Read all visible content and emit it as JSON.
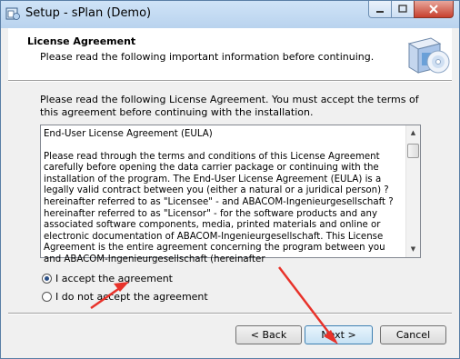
{
  "window": {
    "title": "Setup - sPlan (Demo)",
    "accent_color": "#c7402e"
  },
  "header": {
    "title": "License Agreement",
    "subtitle": "Please read the following important information before continuing.",
    "graphic_icon": "setup-box-with-disc-icon"
  },
  "body": {
    "intro": "Please read the following License Agreement. You must accept the terms of this agreement before continuing with the installation.",
    "license_paragraphs": [
      "End-User License Agreement (EULA)",
      "Please read through the terms and conditions of this License Agreement carefully before opening the data carrier package or continuing with the installation of the program. The End-User License Agreement (EULA) is a legally valid contract between you (either a natural or a juridical person) ?hereinafter referred to as \"Licensee\" - and ABACOM-Ingenieurgesellschaft ?hereinafter referred to as \"Licensor\" - for the software products and any associated software components, media, printed materials and online or electronic documentation of ABACOM-Ingenieurgesellschaft. This License Agreement is the entire agreement concerning the program between you and ABACOM-Ingenieurgesellschaft (hereinafter"
    ]
  },
  "options": {
    "accept_label": "I accept the agreement",
    "decline_label": "I do not accept the agreement",
    "selected": "accept"
  },
  "buttons": {
    "back": "< Back",
    "next": "Next >",
    "cancel": "Cancel"
  },
  "annotation_color": "#e8322a"
}
